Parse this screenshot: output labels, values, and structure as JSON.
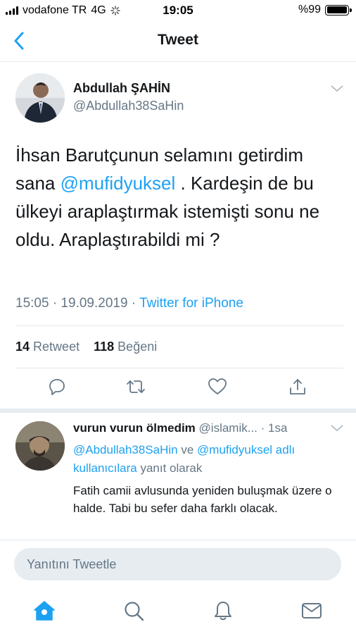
{
  "status_bar": {
    "carrier": "vodafone TR",
    "network": "4G",
    "time": "19:05",
    "battery": "%99",
    "battery_level": 0.99
  },
  "nav": {
    "title": "Tweet",
    "back_icon": "chevron-left-icon"
  },
  "tweet": {
    "author_name": "Abdullah ŞAHİN",
    "author_handle": "@Abdullah38SaHin",
    "text_1": "İhsan Barutçunun selamını getirdim sana ",
    "mention": "@mufidyuksel",
    "text_2": " . Kardeşin de bu ülkeyi araplaştırmak istemişti sonu ne oldu. Araplaştırabildi mi ?",
    "timestamp": "15:05 · 19.09.2019 · ",
    "source": "Twitter for iPhone",
    "retweet_count": "14",
    "retweet_label": "Retweet",
    "like_count": "118",
    "like_label": "Beğeni"
  },
  "reply": {
    "name": "vurun vurun ölmedim",
    "handle": "@islamik...",
    "time": "· 1sa",
    "context_mention_1": "@Abdullah38SaHin",
    "context_connector": " ve ",
    "context_mention_2": "@mufidyuksel adlı kullanıcılara",
    "context_suffix": " yanıt olarak",
    "text": "Fatih camii avlusunda yeniden buluşmak üzere o halde. Tabi bu sefer daha farklı olacak."
  },
  "compose": {
    "placeholder": "Yanıtını Tweetle"
  },
  "tabs": [
    "home-icon",
    "search-icon",
    "notifications-icon",
    "messages-icon"
  ],
  "colors": {
    "accent": "#1da1f2",
    "secondary_text": "#657786",
    "divider": "#e1e8ed"
  }
}
